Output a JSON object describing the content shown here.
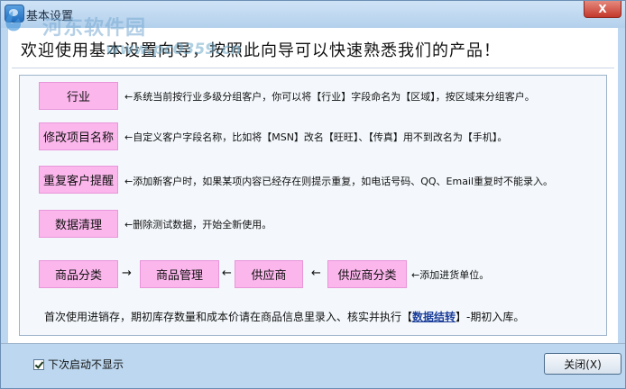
{
  "window": {
    "title": "基本设置",
    "close_glyph": "X"
  },
  "watermark": {
    "line1": "河东软件园",
    "line2": "www.pc0359.cn"
  },
  "headline": "欢迎使用基本设置向导，按照此向导可以快速熟悉我们的产品！",
  "rows": [
    {
      "button": "行业",
      "desc": "←系统当前按行业多级分组客户，你可以将【行业】字段命名为【区域】，按区域来分组客户。"
    },
    {
      "button": "修改项目名称",
      "desc": "←自定义客户字段名称，比如将【MSN】改名【旺旺】、【传真】用不到改名为【手机】。"
    },
    {
      "button": "重复客户提醒",
      "desc": "←添加新客户时，如果某项内容已经存在则提示重复，如电话号码、QQ、Email重复时不能录入。"
    },
    {
      "button": "数据清理",
      "desc": "←删除测试数据，开始全新使用。"
    }
  ],
  "flow": {
    "items": [
      "商品分类",
      "商品管理",
      "供应商",
      "供应商分类"
    ],
    "arrows": [
      "→",
      "←",
      "←"
    ],
    "desc": "←添加进货单位。"
  },
  "note": {
    "before": "首次使用进销存，期初库存数量和成本价请在商品信息里录入、核实并执行【",
    "link": "数据结转",
    "after": "】-期初入库。"
  },
  "footer": {
    "checkbox_label": "下次启动不显示",
    "checkbox_checked": true,
    "close_button": "关闭(X)"
  }
}
